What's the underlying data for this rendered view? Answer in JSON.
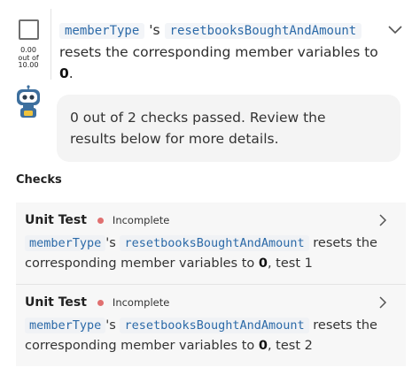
{
  "header": {
    "score_value": "0.00",
    "score_of": "out of",
    "score_max": "10.00",
    "title": {
      "code1": "memberType",
      "between": "'s",
      "code2": "resetbooksBoughtAndAmount",
      "text": "resets the corresponding member variables to",
      "bold": "0",
      "end": "."
    }
  },
  "bot": {
    "message": "0 out of 2 checks passed. Review the results below for more details."
  },
  "checks": {
    "heading": "Checks",
    "items": [
      {
        "type": "Unit Test",
        "status": "Incomplete",
        "code1": "memberType",
        "between": "'s",
        "code2": "resetbooksBoughtAndAmount",
        "text": "resets the corresponding member variables to",
        "bold": "0",
        "suffix": ", test 1"
      },
      {
        "type": "Unit Test",
        "status": "Incomplete",
        "code1": "memberType",
        "between": "'s",
        "code2": "resetbooksBoughtAndAmount",
        "text": "resets the corresponding member variables to",
        "bold": "0",
        "suffix": ", test 2"
      }
    ]
  },
  "colors": {
    "status_incomplete": "#e07070",
    "code_text": "#2c6aa8"
  },
  "icons": {
    "header_toggle": "chevron-down-icon",
    "card_toggle": "chevron-right-icon",
    "assistant": "robot-icon"
  }
}
